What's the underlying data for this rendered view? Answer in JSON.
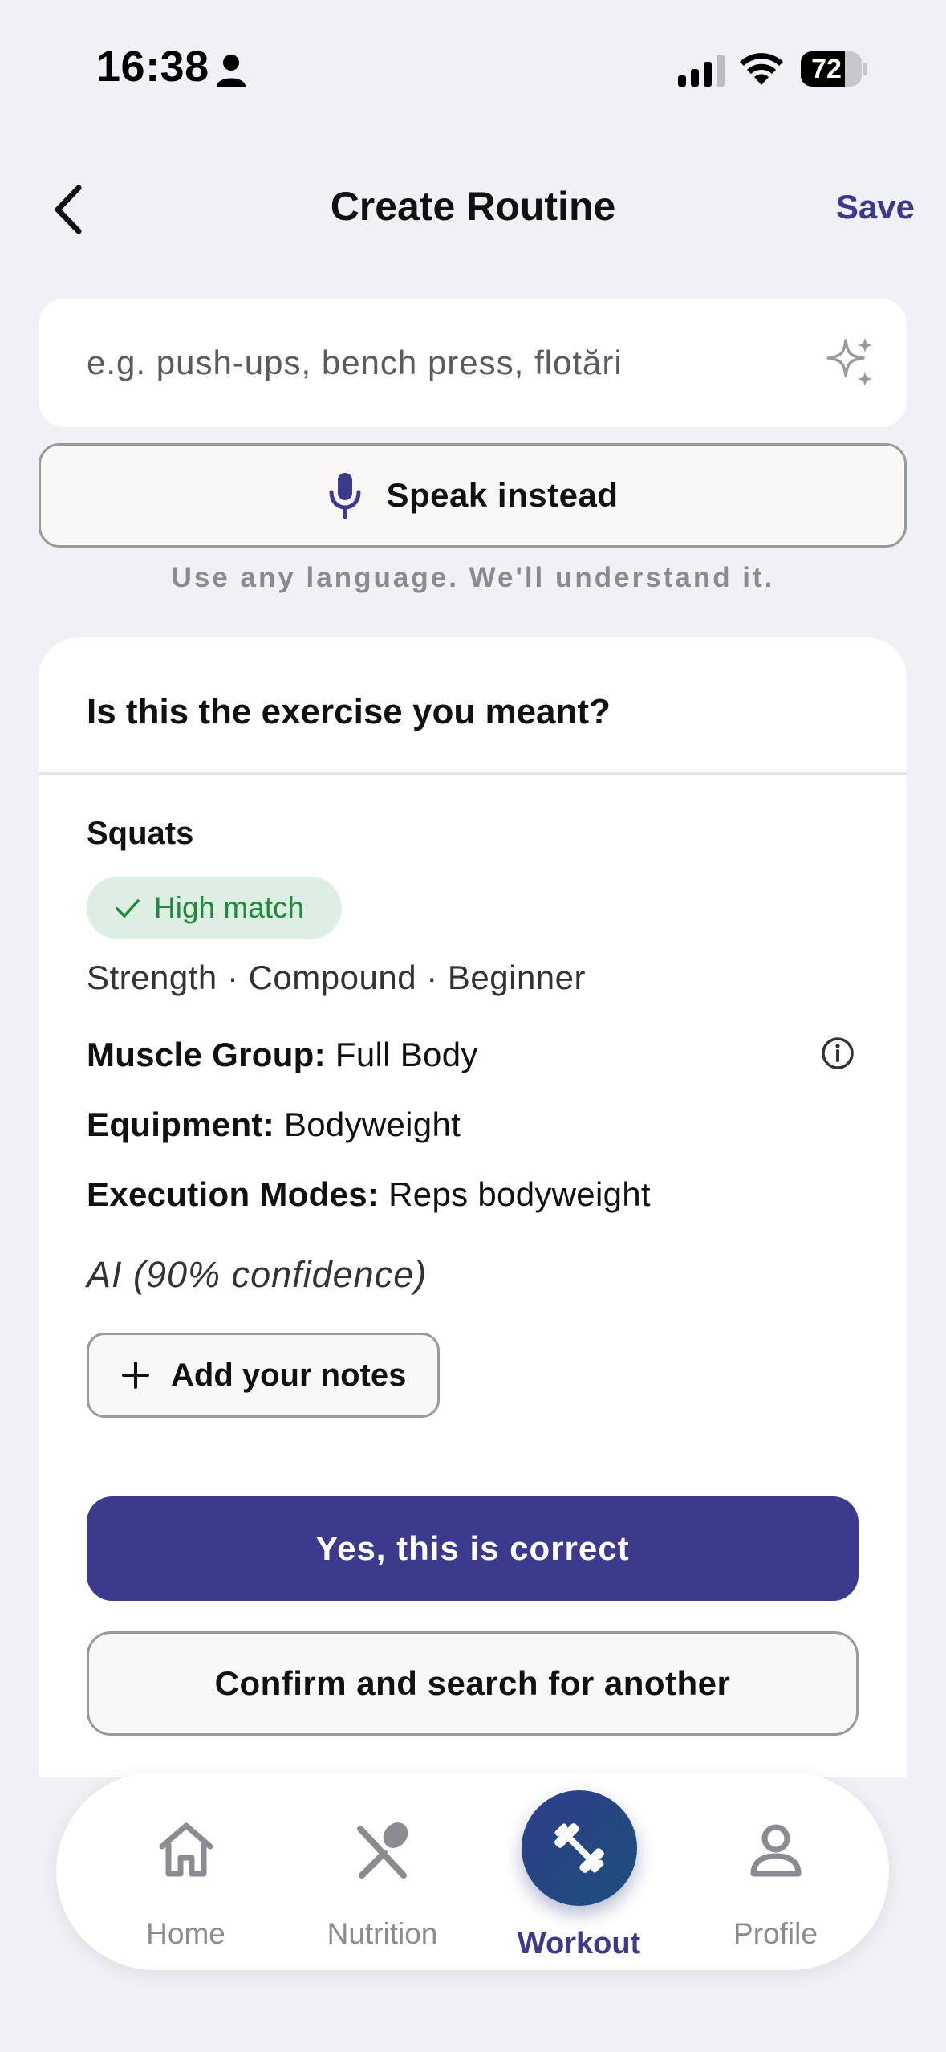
{
  "status_bar": {
    "time": "16:38",
    "battery_percent": 72,
    "battery_text": "72"
  },
  "header": {
    "title": "Create Routine",
    "save_label": "Save",
    "back_icon": "chevron-left-icon"
  },
  "search": {
    "placeholder": "e.g. push-ups, bench press, flotări",
    "value": "",
    "icon": "sparkle-icon"
  },
  "speak": {
    "label": "Speak instead",
    "helper": "Use any language. We'll understand it."
  },
  "suggestion_card": {
    "question": "Is this the exercise you meant?",
    "exercise_name": "Squats",
    "match_badge": "High match",
    "meta": "Strength · Compound · Beginner",
    "muscle_group_key": "Muscle Group:",
    "muscle_group_value": " Full Body",
    "equipment_key": "Equipment:",
    "equipment_value": " Bodyweight",
    "execution_modes_key": "Execution Modes:",
    "execution_modes_value": " Reps bodyweight",
    "ai_confidence": "AI (90% confidence)",
    "add_notes_label": "Add your notes",
    "confirm_label": "Yes, this is correct",
    "confirm_another_label": "Confirm and search for another"
  },
  "tabbar": {
    "tabs": [
      {
        "label": "Home",
        "icon": "home-icon",
        "active": false
      },
      {
        "label": "Nutrition",
        "icon": "nutrition-icon",
        "active": false
      },
      {
        "label": "Workout",
        "icon": "dumbbell-icon",
        "active": true
      },
      {
        "label": "Profile",
        "icon": "profile-icon",
        "active": false
      }
    ]
  },
  "colors": {
    "accent": "#3c3a8c",
    "background": "#f0f1f5",
    "match_green": "#1f8a3c",
    "match_badge_bg": "#dcefe2"
  }
}
